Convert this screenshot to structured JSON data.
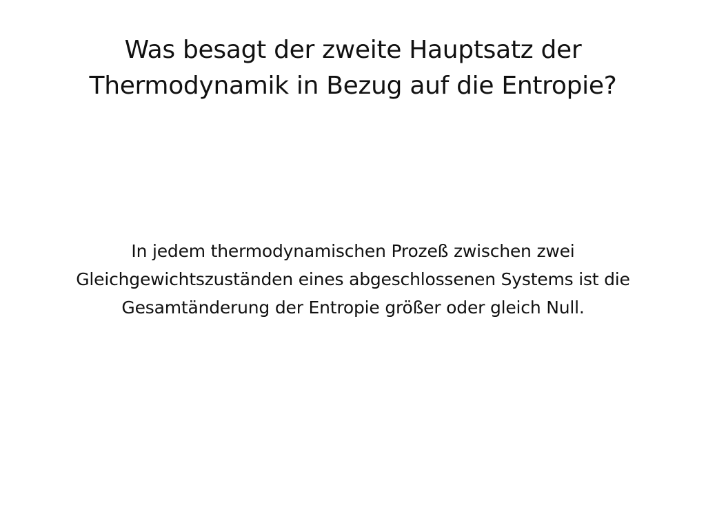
{
  "card": {
    "question": "Was besagt der zweite Hauptsatz der Thermodynamik in Bezug auf die Entropie?",
    "answer": "In jedem thermodynamischen Prozeß zwischen zwei Gleichgewichtszuständen eines abgeschlossenen Systems ist die Gesamtänderung der Entropie größer oder gleich Null."
  }
}
